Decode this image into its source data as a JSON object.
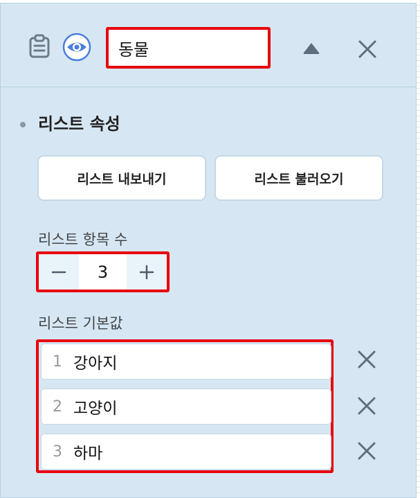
{
  "header": {
    "list_name": "동물",
    "icons": [
      "clipboard-icon",
      "eye-icon",
      "collapse-up-icon",
      "close-icon"
    ]
  },
  "section": {
    "title": "리스트 속성"
  },
  "buttons": {
    "export_label": "리스트 내보내기",
    "import_label": "리스트 불러오기"
  },
  "item_count": {
    "label": "리스트 항목 수",
    "value": "3",
    "decrement_icon": "minus-icon",
    "increment_icon": "plus-icon"
  },
  "default_values": {
    "label": "리스트 기본값",
    "items": [
      {
        "index": "1",
        "value": "강아지"
      },
      {
        "index": "2",
        "value": "고양이"
      },
      {
        "index": "3",
        "value": "하마"
      }
    ],
    "remove_icon": "close-icon"
  },
  "colors": {
    "panel_background": "#d6e7f3",
    "highlight_border": "#e8000b",
    "eye_icon": "#4a7ee0",
    "icon_gray": "#5f6e7c"
  }
}
